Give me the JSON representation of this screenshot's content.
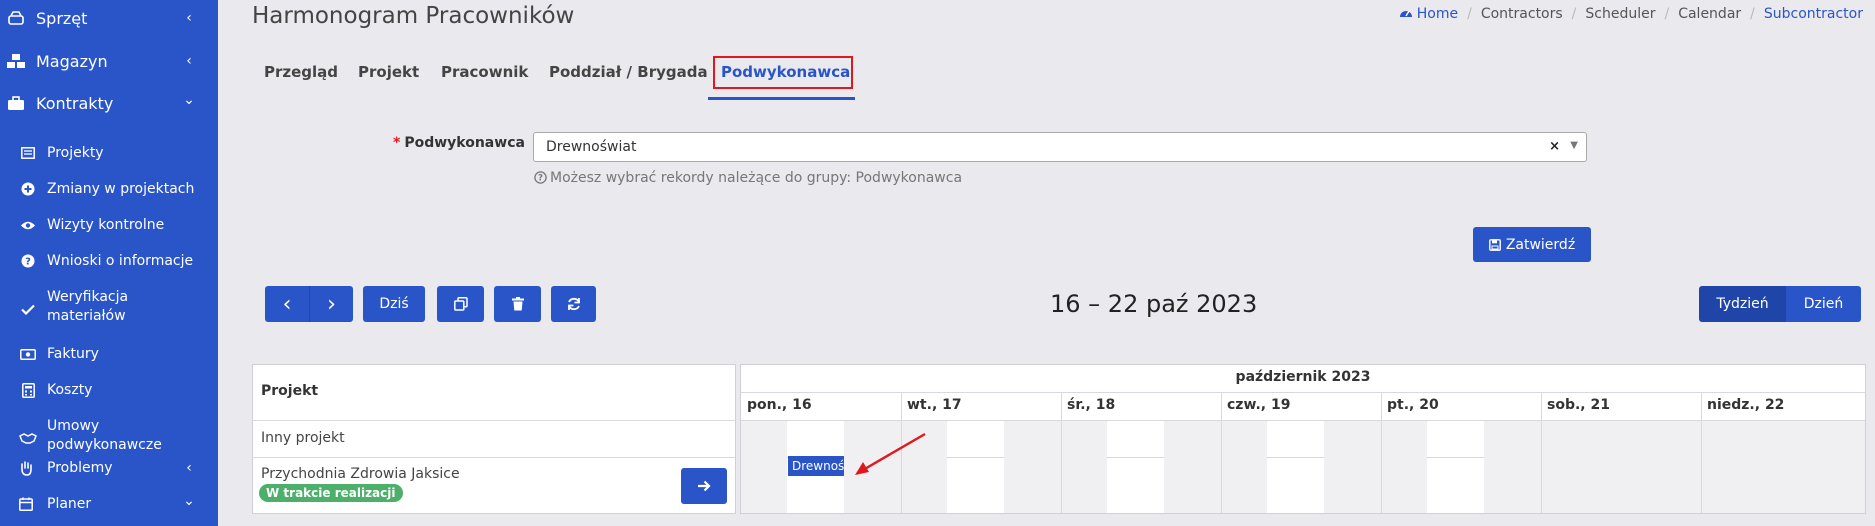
{
  "sidebar": {
    "items": [
      {
        "label": "Sprzęt",
        "icon": "hdd-icon",
        "chevron": "‹"
      },
      {
        "label": "Magazyn",
        "icon": "cubes-icon",
        "chevron": "‹"
      },
      {
        "label": "Kontrakty",
        "icon": "briefcase-icon",
        "chevron": "⌄"
      }
    ],
    "subitems": [
      {
        "label": "Projekty",
        "icon": "list-icon"
      },
      {
        "label": "Zmiany w projektach",
        "icon": "plus-circle-icon"
      },
      {
        "label": "Wizyty kontrolne",
        "icon": "eye-icon"
      },
      {
        "label": "Wnioski o informacje",
        "icon": "question-circle-icon"
      },
      {
        "label": "Weryfikacja",
        "label2": "materiałów",
        "icon": "check-icon"
      },
      {
        "label": "Faktury",
        "icon": "money-bill-icon"
      },
      {
        "label": "Koszty",
        "icon": "calculator-icon"
      },
      {
        "label": "Umowy",
        "label2": "podwykonawcze",
        "icon": "handshake-icon"
      }
    ],
    "bottom": [
      {
        "label": "Problemy",
        "icon": "hand-icon",
        "chevron": "‹"
      },
      {
        "label": "Planer",
        "icon": "calendar-icon",
        "chevron": "⌄"
      }
    ]
  },
  "header": {
    "title": "Harmonogram Pracowników",
    "breadcrumb": [
      "Home",
      "Contractors",
      "Scheduler",
      "Calendar",
      "Subcontractor"
    ]
  },
  "tabs": [
    "Przegląd",
    "Projekt",
    "Pracownik",
    "Poddział / Brygada",
    "Podwykonawca"
  ],
  "form": {
    "label": "Podwykonawca",
    "required_mark": "*",
    "value": "Drewnoświat",
    "clear": "×",
    "help": "Możesz wybrać rekordy należące do grupy: Podwykonawca",
    "submit": "Zatwierdź"
  },
  "toolbar": {
    "prev": "‹",
    "next": "›",
    "today": "Dziś"
  },
  "calendar": {
    "range": "16 – 22 paź 2023",
    "views": [
      "Tydzień",
      "Dzień"
    ],
    "month": "październik 2023",
    "days": [
      "pon., 16",
      "wt., 17",
      "śr., 18",
      "czw., 19",
      "pt., 20",
      "sob., 21",
      "niedz., 22"
    ],
    "project_header": "Projekt",
    "rows": [
      {
        "name": "Inny projekt"
      },
      {
        "name": "Przychodnia Zdrowia Jaksice",
        "status": "W trakcie realizacji"
      }
    ],
    "event_label": "Drewnoś"
  },
  "colors": {
    "primary": "#2a55c9",
    "success": "#4caf6a",
    "highlight": "#e0181e"
  }
}
